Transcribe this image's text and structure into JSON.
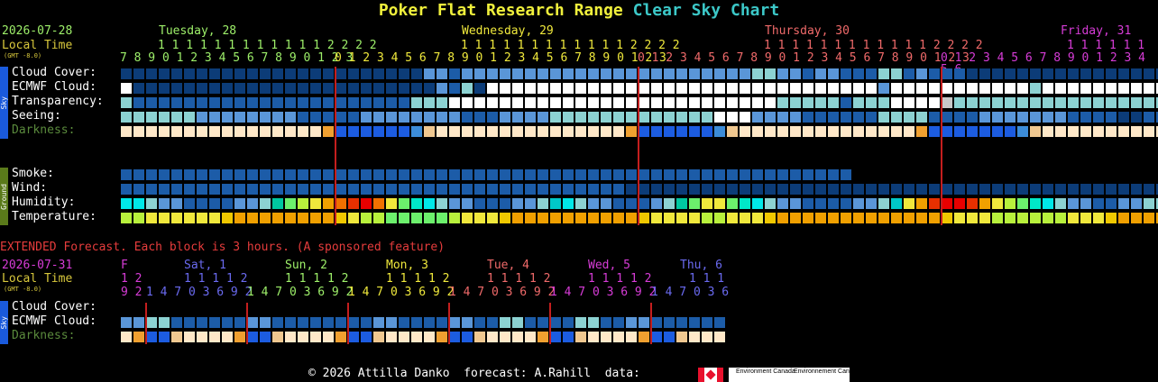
{
  "title": {
    "part1": "Poker Flat Research Range",
    "part2": "Clear Sky Chart"
  },
  "main": {
    "date": "2026-07-28",
    "local_time": "Local Time",
    "gmt": "(GMT -8.0)",
    "days": [
      {
        "label": "Tuesday, 28",
        "color": "#9ef06a",
        "tens": "1 1 1 1 1 1 1 1 1 1 1 1 2 2 2 2",
        "hours": "7 8 9 0 1 2 3 4 5 6 7 8 9 0 1 2 3"
      },
      {
        "label": "Wednesday, 29",
        "color": "#f0e93c",
        "tens": "1 1 1 1 1 1 1 1 1 1 1 1 2 2 2 2",
        "hours": "0 1 2 3 4 5 6 7 8 9 0 1 2 3 4 5 6 7 8 9 0 1 2 3"
      },
      {
        "label": "Thursday, 30",
        "color": "#f06a6a",
        "tens": "1 1 1 1 1 1 1 1 1 1 1 1 2 2 2 2",
        "hours": "0 1 2 3 4 5 6 7 8 9 0 1 2 3 4 5 6 7 8 9 0 1 2 3"
      },
      {
        "label": "Friday, 31",
        "color": "#d73cd7",
        "tens": "1 1 1 1 1 1",
        "hours": "0 1 2 3 4 5 6 7 8 9 0 1 2 3 4 5 6"
      }
    ],
    "sky_side_label": "Sky",
    "ground_side_label": "Ground",
    "rows_sky": {
      "cloud": "Cloud Cover:",
      "ecmwf": "ECMWF Cloud:",
      "transparency": "Transparency:",
      "seeing": "Seeing:",
      "darkness": "Darkness:"
    },
    "rows_ground": {
      "smoke": "Smoke:",
      "wind": "Wind:",
      "humidity": "Humidity:",
      "temperature": "Temperature:"
    }
  },
  "extended": {
    "notice": "EXTENDED Forecast. Each block is 3 hours. (A sponsored feature)",
    "date": "2026-07-31",
    "local_time": "Local Time",
    "gmt": "(GMT -8.0)",
    "days": [
      {
        "label": "F",
        "color": "#d73cd7",
        "tens": "1 2",
        "hours": "9 2"
      },
      {
        "label": "Sat, 1",
        "color": "#6a6af0",
        "tens": "1 1 1 1 2",
        "hours": "1 4 7 0 3 6 9 2"
      },
      {
        "label": "Sun, 2",
        "color": "#9ef06a",
        "tens": "1 1 1 1 2",
        "hours": "1 4 7 0 3 6 9 2"
      },
      {
        "label": "Mon, 3",
        "color": "#f0e93c",
        "tens": "1 1 1 1 2",
        "hours": "1 4 7 0 3 6 9 2"
      },
      {
        "label": "Tue, 4",
        "color": "#f06a6a",
        "tens": "1 1 1 1 2",
        "hours": "1 4 7 0 3 6 9 2"
      },
      {
        "label": "Wed, 5",
        "color": "#d73cd7",
        "tens": "1 1 1 1 2",
        "hours": "1 4 7 0 3 6 9 2"
      },
      {
        "label": "Thu, 6",
        "color": "#6a6af0",
        "tens": "1 1 1",
        "hours": "1 4 7 0 3 6"
      }
    ],
    "rows": {
      "cloud": "Cloud Cover:",
      "ecmwf": "ECMWF Cloud:",
      "darkness": "Darkness:"
    }
  },
  "footer": {
    "copyright": "© 2026 Attilla Danko  forecast: A.Rahill  data:",
    "ec_en": "Environment Canada",
    "ec_fr": "Environnement Canada"
  },
  "colors": {
    "title_yellow": "#f0f03c",
    "title_cyan": "#3cc8c8",
    "date_green": "#9ef06a",
    "local_time_yellow": "#d8c83c",
    "darkness_label": "#5a8a3c",
    "extended_notice": "#e63c3c",
    "midnight_line": "#c41e1e",
    "side_sky": "#1a5adc",
    "side_ground": "#5a7a1a"
  },
  "legend_codes": {
    "d": "#0c3c78 dark blue (clear / good)",
    "m": "#1c5ca8 medium blue",
    "l": "#5a96d8 light blue",
    "c": "#8cd2d2 cyan",
    "w": "#ffffff white (overcast / poor)",
    "g": "#c8c8c8 grey"
  },
  "grid": {
    "main_cols": 86,
    "ext_cols": 24,
    "cloud": "ddddddddddddddddddddddddllmlllllllllllllllllllllllccllmllmmmccmlmmmdddddddddddddddddddddddddddddddddddddddddddll",
    "ecmwf": "wddddddddddddddddddddddddlmcdwwwwwwwwwwwwwwwwwwwwwwwwwwwwwwwlwwwwwwwwwwwcwwwwwwwwwwccdddddddllllllldddddd",
    "transparency": "cmmmmmmmmmmmmmmmmmmmmmmcccwwwwwwwwwwwwwwwwwwwwwwwwwwcccccmcccwwwwgcccccccccccccccccccccccccmmmmmmmmmmmmmm",
    "seeing": "ccccccllllllllmmmmmllllllllmmmllllcccccccccccccwwwllllmmmmmmccccmmmmlllllllmmmmddmmmmddddmmmmmmmmmmmm",
    "smoke": "mmmmmmmmmmmmmmmmmmmmmmmmmmmmmmmmmmmmmmmmmmmmmmmmmmmmmmmmmmmmmmmmmmmm",
    "wind": "mmmmmmmmmmmmmmmmmmmmmmmmmmmmmmmmmmmmmmmmmmmmmmmmmmmmmmmmmmmmmmmmmmmmmmmmmmmmmmmmmmmmmmmm",
    "ext_cloud": "lccmmmlmmmmmlmmmmcmccmmmmmmmmlwwwlm",
    "ext_ecmwf": ""
  }
}
